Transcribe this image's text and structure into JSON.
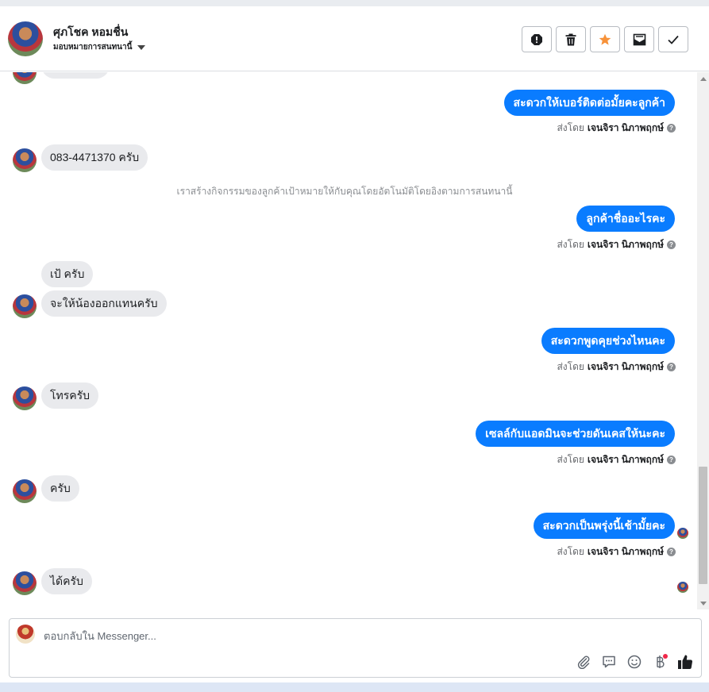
{
  "header": {
    "contact_name": "ศุภโชค หอมชื่น",
    "assign_label": "มอบหมายการสนทนานี้",
    "actions": [
      {
        "name": "spam-button",
        "icon": "alert-octagon-icon"
      },
      {
        "name": "delete-button",
        "icon": "trash-icon"
      },
      {
        "name": "star-button",
        "icon": "star-icon",
        "color": "#f7923a"
      },
      {
        "name": "mark-unread-button",
        "icon": "envelope-icon"
      },
      {
        "name": "mark-done-button",
        "icon": "checkmark-icon"
      }
    ]
  },
  "conversation": {
    "sent_by_prefix": "ส่งโดย",
    "agent_name": "เจนจิรา นิภาพฤกษ์",
    "messages": [
      {
        "direction": "out",
        "text": "สะดวกให้เบอร์ติดต่อมั้ยคะลูกค้า"
      },
      {
        "direction": "in",
        "text": "083-4471370 ครับ"
      },
      {
        "direction": "system",
        "text": "เราสร้างกิจกรรมของลูกค้าเป้าหมายให้กับคุณโดยอัตโนมัติโดยอิงตามการสนทนานี้"
      },
      {
        "direction": "out",
        "text": "ลูกค้าชื่ออะไรคะ"
      },
      {
        "direction": "in",
        "text": "เป้ ครับ"
      },
      {
        "direction": "in",
        "text": "จะให้น้องออกแทนครับ"
      },
      {
        "direction": "out",
        "text": "สะดวกพูดคุยช่วงไหนคะ"
      },
      {
        "direction": "in",
        "text": "โทรครับ"
      },
      {
        "direction": "out",
        "text": "เซลล์กับแอดมินจะช่วยดันเคสให้นะคะ"
      },
      {
        "direction": "in",
        "text": "ครับ"
      },
      {
        "direction": "out",
        "text": "สะดวกเป็นพรุ่งนี้เช้ามั้ยคะ"
      },
      {
        "direction": "in",
        "text": "ได้ครับ"
      }
    ]
  },
  "composer": {
    "placeholder": "ตอบกลับใน Messenger...",
    "tools": [
      "attach-icon",
      "saved-reply-icon",
      "emoji-icon",
      "baht-payment-icon",
      "thumbs-up-icon"
    ]
  },
  "colors": {
    "outgoing_bubble": "#0a7cff",
    "incoming_bubble": "#e9eaed",
    "notification_dot": "#f02849"
  }
}
